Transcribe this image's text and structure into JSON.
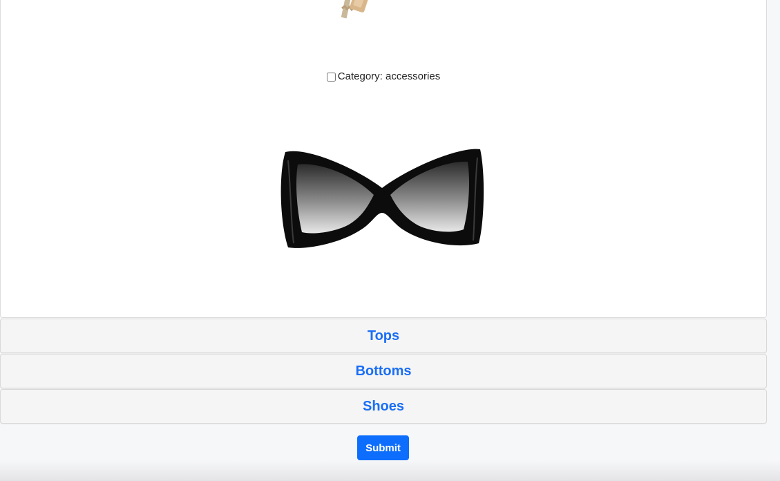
{
  "items": [
    {
      "image": "keys-image",
      "checkbox_checked": false,
      "label": "Category: accessories"
    },
    {
      "image": "sunglasses-image"
    }
  ],
  "sections": [
    {
      "label": "Tops"
    },
    {
      "label": "Bottoms"
    },
    {
      "label": "Shoes"
    }
  ],
  "submit_label": "Submit",
  "colors": {
    "accent": "#1a6ef5",
    "button": "#0d6efd"
  }
}
